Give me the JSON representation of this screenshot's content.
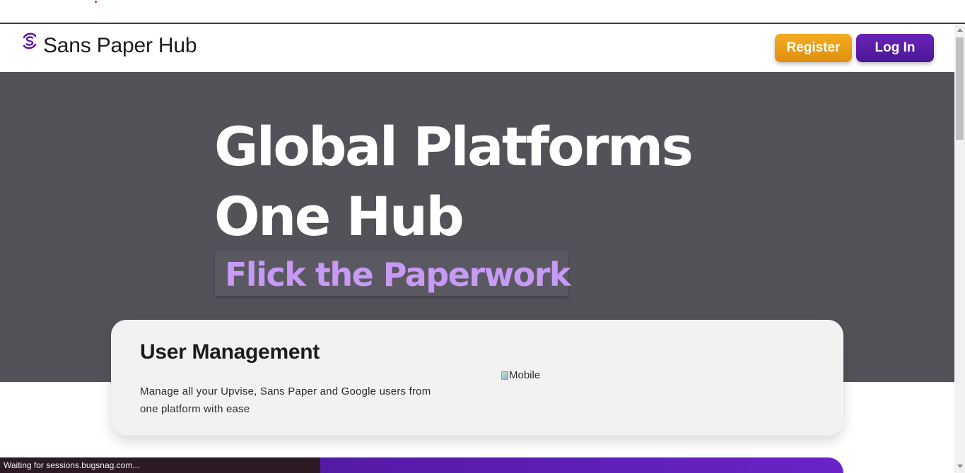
{
  "header": {
    "brand": "Sans Paper Hub",
    "logo_icon": "sans-paper-s-logo-icon",
    "register_label": "Register",
    "login_label": "Log In"
  },
  "hero": {
    "title_line1": "Global Platforms",
    "title_line2": "One Hub",
    "tagline": "Flick the Paperwork"
  },
  "feature_card": {
    "title": "User Management",
    "description": "Manage all your Upvise, Sans Paper and Google users from one platform with ease",
    "image_alt": "Mobile"
  },
  "status_bar": {
    "text": "Waiting for sessions.bugsnag.com..."
  },
  "colors": {
    "register": "#e8980f",
    "login": "#5a1ca8",
    "hero_bg": "#545259",
    "tagline": "#c79af5",
    "logo": "#5a1ca8"
  }
}
